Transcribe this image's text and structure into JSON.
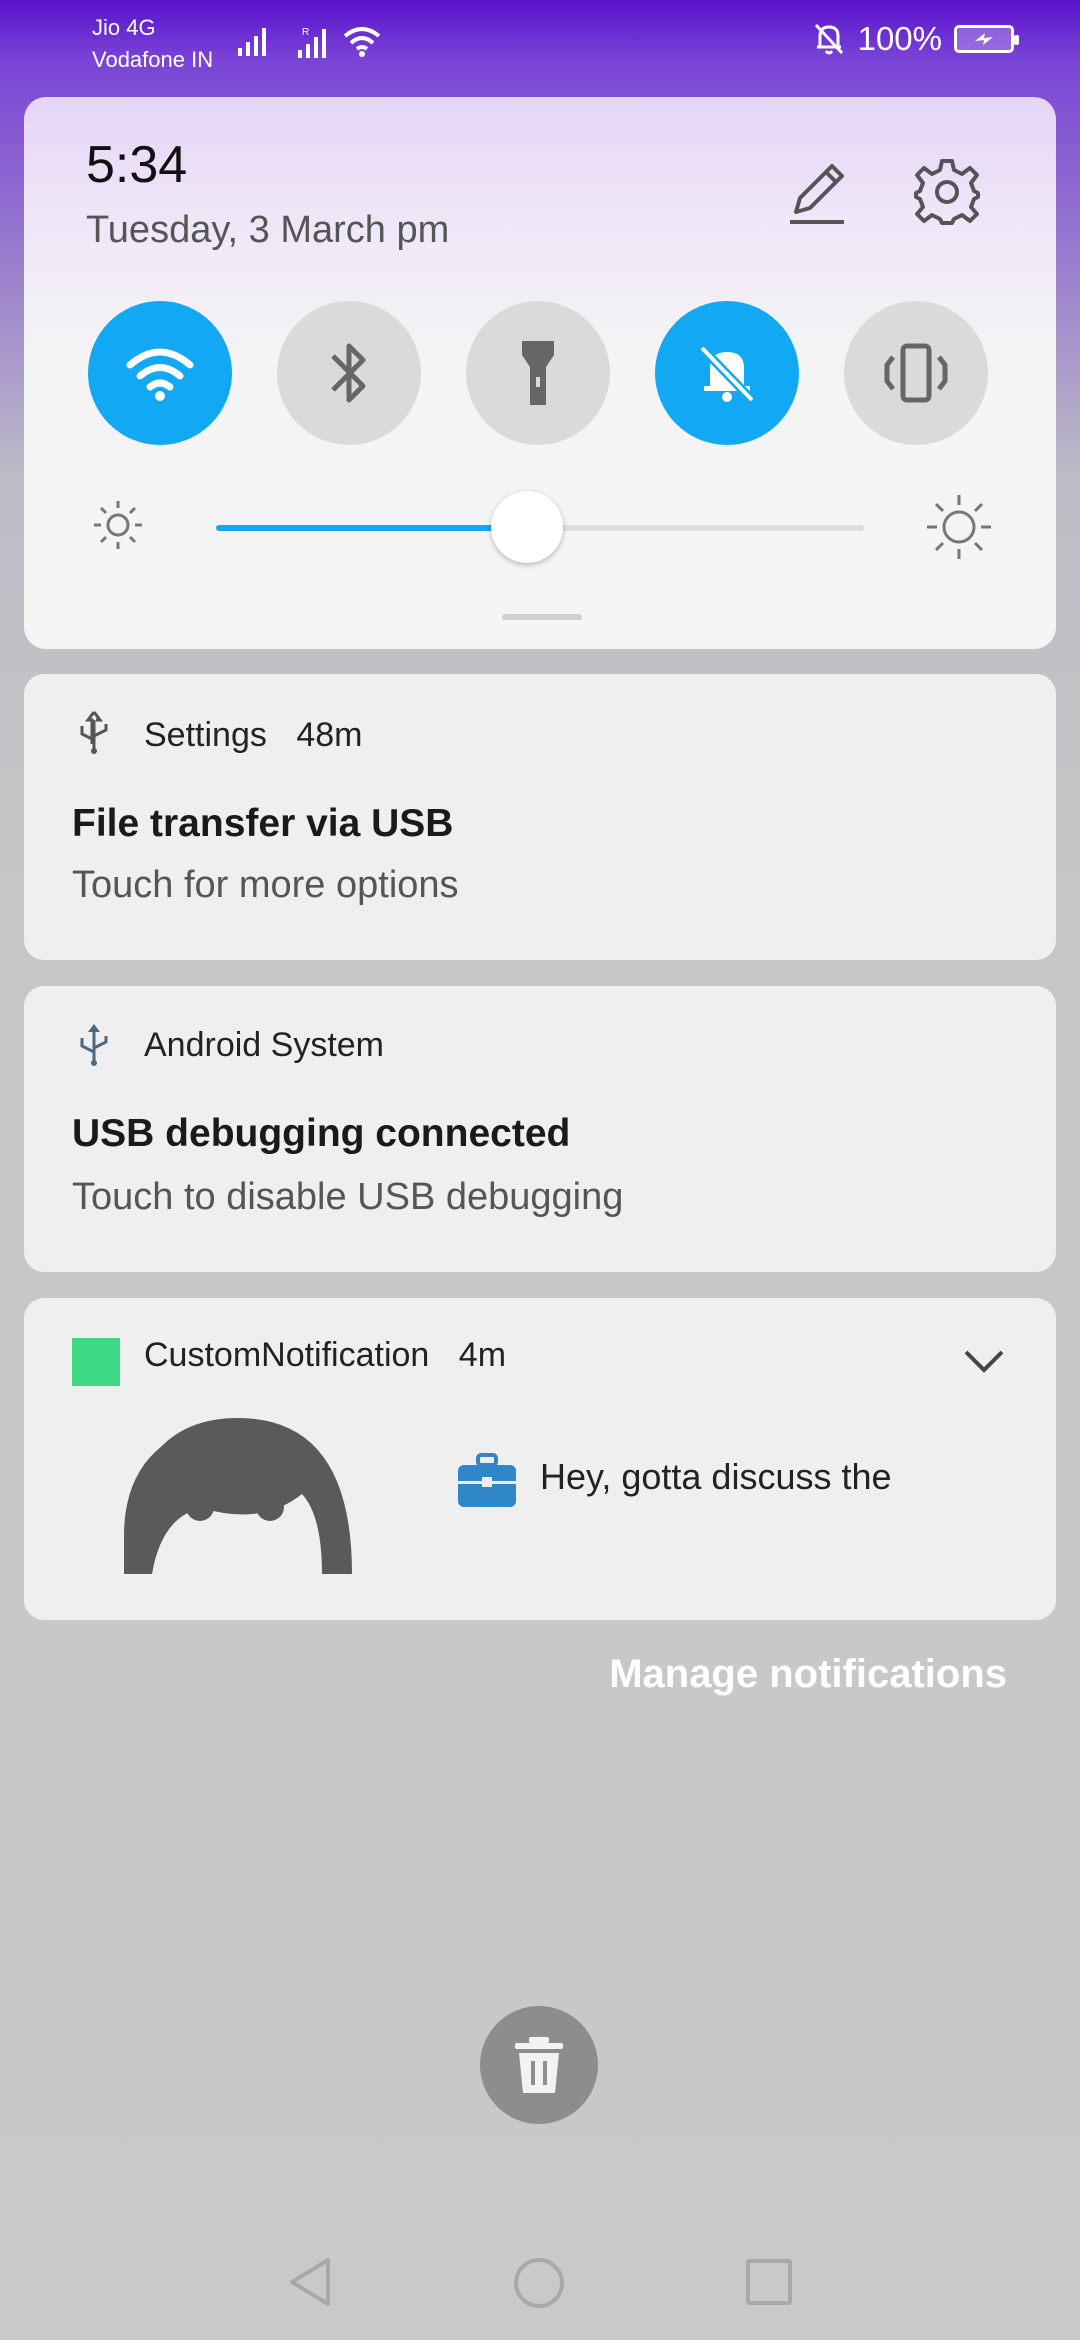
{
  "status_bar": {
    "carrier_1": "Jio 4G",
    "carrier_2": "Vodafone IN",
    "battery": "100%",
    "icons": [
      "signal-icon",
      "roaming-signal-icon",
      "wifi-icon",
      "bell-off-icon",
      "battery-charging-icon"
    ]
  },
  "quick_settings": {
    "time": "5:34",
    "date": "Tuesday, 3 March  pm",
    "icons": [
      "edit-icon",
      "gear-icon"
    ],
    "toggles": [
      {
        "name": "wifi",
        "icon": "wifi-icon",
        "on": true
      },
      {
        "name": "bluetooth",
        "icon": "bluetooth-icon",
        "on": false
      },
      {
        "name": "flashlight",
        "icon": "flashlight-icon",
        "on": false
      },
      {
        "name": "silent",
        "icon": "bell-off-icon",
        "on": true
      },
      {
        "name": "vibrate",
        "icon": "vibrate-icon",
        "on": false
      }
    ],
    "brightness_level": 0.48,
    "accent_color": "#12a8f3"
  },
  "notifications": [
    {
      "app": "Settings",
      "time": "48m",
      "title": "File transfer via USB",
      "text": "Touch for more options",
      "icon": "usb-icon"
    },
    {
      "app": "Android System",
      "time": "",
      "title": "USB debugging connected",
      "text": "Touch to disable USB debugging",
      "icon": "usb-icon"
    },
    {
      "app": "CustomNotification",
      "time": "4m",
      "message": "Hey, gotta discuss the",
      "icon": "app-square-icon",
      "app_color": "#3fd884"
    }
  ],
  "manage_label": "Manage notifications",
  "clear_icon": "trash-icon",
  "nav_icons": [
    "back-icon",
    "home-icon",
    "recents-icon"
  ]
}
